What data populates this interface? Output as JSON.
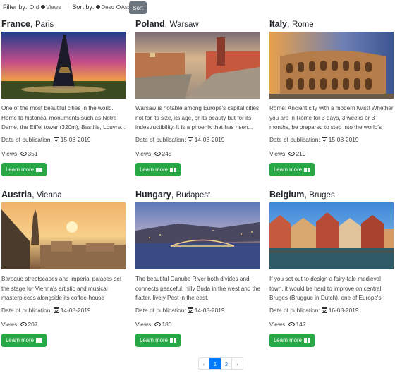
{
  "filter": {
    "label": "Filter by:",
    "options": [
      "Id",
      "Views"
    ],
    "selected": "Views"
  },
  "sort": {
    "label": "Sort by:",
    "options": [
      "Desc",
      "Asc"
    ],
    "selected": "Desc",
    "button_label": "Sort"
  },
  "cards": [
    {
      "country": "France",
      "capital": "Paris",
      "description": "One of the most beautiful cities in the world. Home to historical monuments such as Notre Dame, the Eiffel tower (320m), Bastille, Louvre...",
      "date_label": "Date of publication:",
      "date": "15-08-2019",
      "views_label": "Views:",
      "views": "351",
      "button_label": "Learn more"
    },
    {
      "country": "Poland",
      "capital": "Warsaw",
      "description": "Warsaw is notable among Europe's capital cities not for its size, its age, or its beauty but for its indestructibility. It is a phoenix that has risen...",
      "date_label": "Date of publication:",
      "date": "14-08-2019",
      "views_label": "Views:",
      "views": "245",
      "button_label": "Learn more"
    },
    {
      "country": "Italy",
      "capital": "Rome",
      "description": "Rome: Ancient city with a modern twist! Whether you are in Rome for 3 days, 3 weeks or 3 months, be prepared to step into the world's biggest...",
      "date_label": "Date of publication:",
      "date": "15-08-2019",
      "views_label": "Views:",
      "views": "219",
      "button_label": "Learn more"
    },
    {
      "country": "Austria",
      "capital": "Vienna",
      "description": "Baroque streetscapes and imperial palaces set the stage for Vienna's artistic and musical masterpieces alongside its coffee-house culture...",
      "date_label": "Date of publication:",
      "date": "14-08-2019",
      "views_label": "Views:",
      "views": "207",
      "button_label": "Learn more"
    },
    {
      "country": "Hungary",
      "capital": "Budapest",
      "description": "The beautiful Danube River both divides and connects peaceful, hilly Buda in the west and the flatter, lively Pest in the east.",
      "date_label": "Date of publication:",
      "date": "14-08-2019",
      "views_label": "Views:",
      "views": "180",
      "button_label": "Learn more"
    },
    {
      "country": "Belgium",
      "capital": "Bruges",
      "description": "If you set out to design a fairy-tale medieval town, it would be hard to improve on central Bruges (Bruggue in Dutch), one of Europe's best...",
      "date_label": "Date of publication:",
      "date": "16-08-2019",
      "views_label": "Views:",
      "views": "147",
      "button_label": "Learn more"
    }
  ],
  "pagination": {
    "prev": "‹",
    "pages": [
      "1",
      "2"
    ],
    "current": "1",
    "next": "›"
  },
  "colors": {
    "accent": "#007bff",
    "button_green": "#28a745",
    "sort_button": "#6c757d"
  }
}
